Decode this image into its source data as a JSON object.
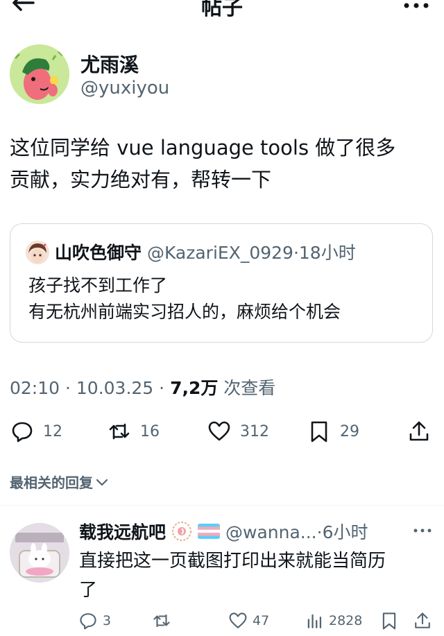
{
  "header": {
    "title": "帖子",
    "back_icon": "arrow-left-icon",
    "more_icon": "more-horizontal-icon"
  },
  "post": {
    "author_name": "尤雨溪",
    "author_handle": "@yuxiyou",
    "text_line1": "这位同学给 vue language tools 做了很多",
    "text_line2": "贡献，实力绝对有，帮转一下",
    "quote": {
      "name": "山吹色御守",
      "meta": "@KazariEX_0929·18小时",
      "line1": "孩子找不到工作了",
      "line2": "有无杭州前端实习招人的，麻烦给个机会"
    },
    "time": "02:10 · 10.03.25 · ",
    "views_count": "7,2万",
    "views_label": " 次查看",
    "actions": {
      "replies": "12",
      "reposts": "16",
      "likes": "312",
      "bookmarks": "29"
    }
  },
  "relevant_replies_label": "最相关的回复",
  "reply": {
    "name": "载我远航吧",
    "meta": "@wanna...·6小时",
    "text_line1": "直接把这一页截图打印出来就能当简历",
    "text_line2": "了",
    "actions": {
      "replies": "3",
      "reposts": "",
      "likes": "47",
      "views": "2828"
    }
  },
  "colors": {
    "text": "#0f1419",
    "secondary": "#536471",
    "border": "#cfd9de"
  }
}
